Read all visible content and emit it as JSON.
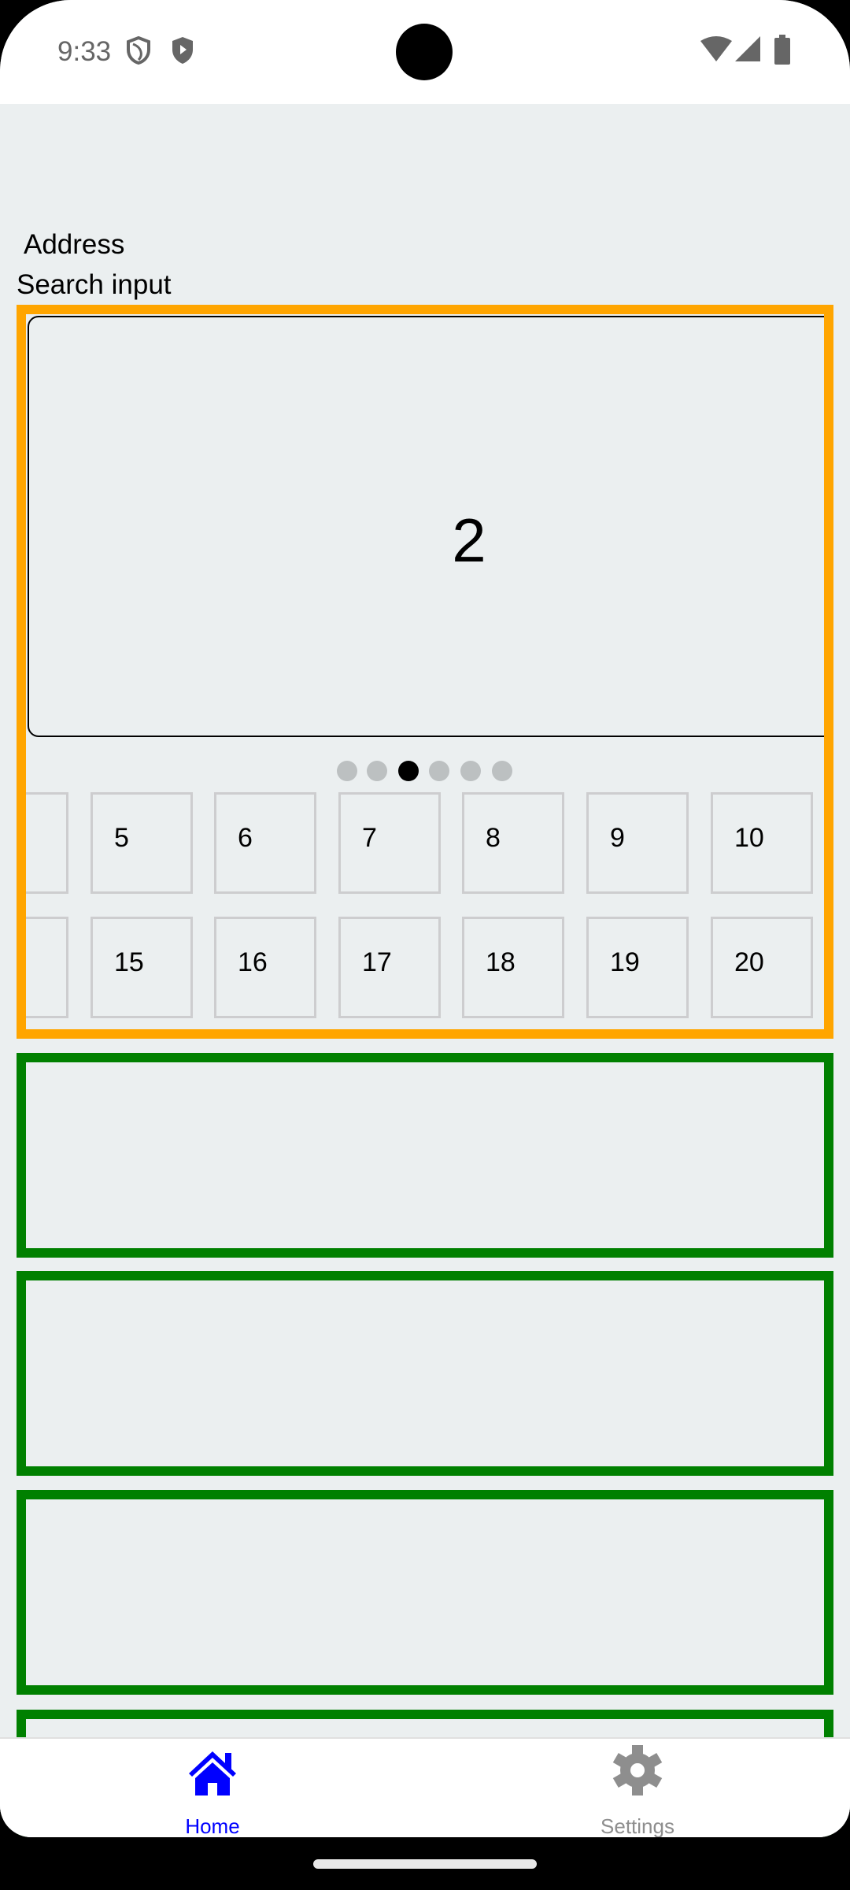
{
  "status_bar": {
    "time": "9:33",
    "icons": [
      "vpn-shield-icon",
      "play-protect-icon",
      "wifi-icon",
      "signal-icon",
      "battery-icon"
    ]
  },
  "form": {
    "address_label": "Address",
    "search_label": "Search input"
  },
  "carousel": {
    "current_page": "2",
    "page_count": 6,
    "active_index": 2
  },
  "grid": {
    "row1": [
      "5",
      "6",
      "7",
      "8",
      "9",
      "10"
    ],
    "row2": [
      "15",
      "16",
      "17",
      "18",
      "19",
      "20"
    ]
  },
  "colors": {
    "highlight_border": "#ffa500",
    "list_border": "#008000",
    "nav_active": "#0000ff",
    "nav_inactive": "#8e8e8e",
    "background": "#ebeff0"
  },
  "bottom_nav": {
    "items": [
      {
        "label": "Home",
        "icon": "home-icon",
        "active": true
      },
      {
        "label": "Settings",
        "icon": "gear-icon",
        "active": false
      }
    ]
  }
}
